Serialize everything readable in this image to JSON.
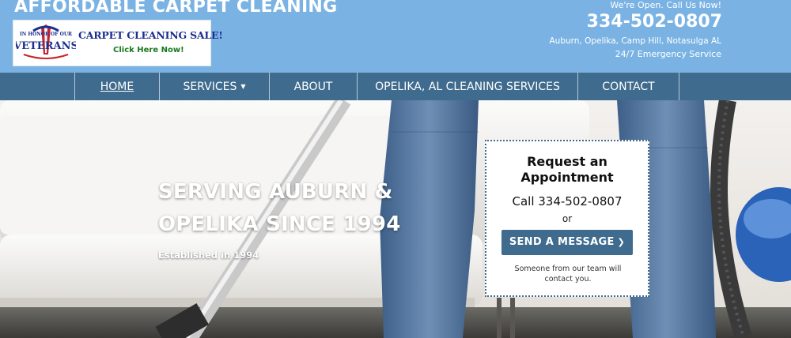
{
  "header": {
    "site_title": "AFFORDABLE CARPET CLEANING",
    "promo": {
      "logo_text": "IN HONOR OF OUR VETERANS",
      "sale_text": "CARPET CLEANING SALE!",
      "click_text": "Click Here Now!"
    },
    "contact": {
      "open_text": "We're Open. Call Us Now!",
      "phone": "334-502-0807",
      "areas": "Auburn, Opelika, Camp Hill, Notasulga AL",
      "emergency": "24/7 Emergency Service"
    }
  },
  "nav": {
    "items": [
      {
        "label": "HOME"
      },
      {
        "label": "SERVICES"
      },
      {
        "label": "ABOUT"
      },
      {
        "label": "OPELIKA, AL CLEANING SERVICES"
      },
      {
        "label": "CONTACT"
      }
    ]
  },
  "hero": {
    "title_line1": "SERVING AUBURN &",
    "title_line2": "OPELIKA SINCE 1994",
    "subtitle": "Established in 1994"
  },
  "appointment": {
    "title_line1": "Request an",
    "title_line2": "Appointment",
    "call_text": "Call 334-502-0807",
    "or_text": "or",
    "button_label": "SEND A MESSAGE",
    "note": "Someone from our team will contact you."
  },
  "colors": {
    "header_bg": "#7ab3e3",
    "nav_bg": "#3f6b8e",
    "button_bg": "#3f6b8e"
  }
}
